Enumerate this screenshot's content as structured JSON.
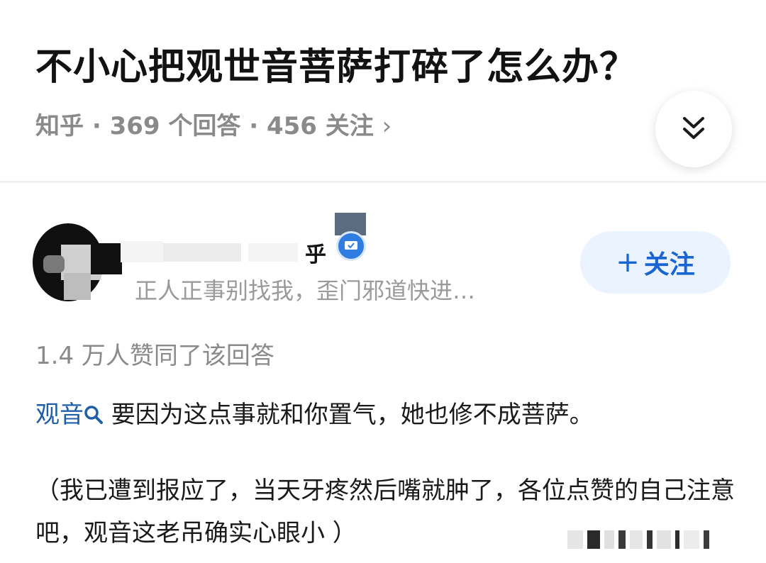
{
  "question": {
    "title": "不小心把观世音菩萨打碎了怎么办？",
    "meta": "知乎 · 369 个回答 · 456 关注",
    "meta_chevron": "›",
    "collapse_icon": "double-chevron-down-icon"
  },
  "author": {
    "name_fragment": "乎",
    "bio": "正人正事别找我，歪门邪道快进…",
    "verified_icon": "verified-badge-icon",
    "follow_plus": "+",
    "follow_label": "关注"
  },
  "answer": {
    "upvotes_text": "1.4 万人赞同了该回答",
    "para1_link": "观音",
    "para1_rest": "要因为这点事就和你置气，她也修不成菩萨。",
    "para2": "（我已遭到报应了，当天牙疼然后嘴就肿了，各位点赞的自己注意吧，观音这老吊确实心眼小 ）"
  },
  "colors": {
    "accent": "#1966d2",
    "follow_bg": "#ebf3fe",
    "meta_gray": "#8a8a8a"
  }
}
